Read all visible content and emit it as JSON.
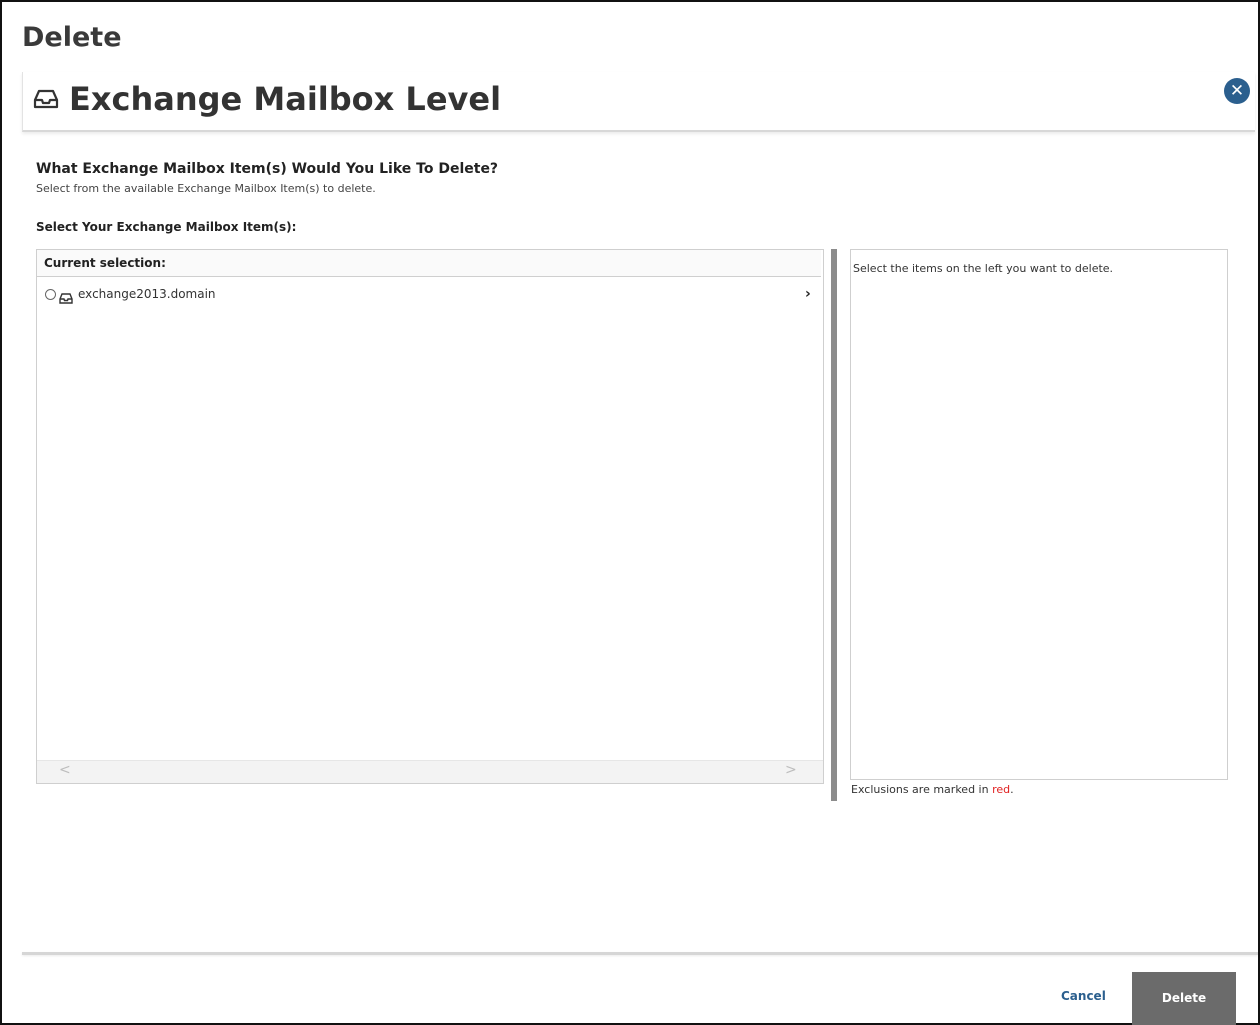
{
  "window": {
    "title": "Delete"
  },
  "header": {
    "icon": "mailbox-icon",
    "title": "Exchange Mailbox Level",
    "close_icon": "close-icon"
  },
  "prompt": {
    "question": "What Exchange Mailbox Item(s) Would You Like To Delete?",
    "subtext": "Select from the available Exchange Mailbox Item(s) to delete.",
    "select_label": "Select Your Exchange Mailbox Item(s):"
  },
  "left_panel": {
    "header": "Current selection:",
    "items": [
      {
        "label": "exchange2013.domain",
        "icon": "mailbox-icon",
        "selected": false,
        "expand_icon": "chevron-right-icon"
      }
    ],
    "scroll_left": "<",
    "scroll_right": ">"
  },
  "right_panel": {
    "hint": "Select the items on the left you want to delete.",
    "exclusions_prefix": "Exclusions are marked in ",
    "exclusions_red": "red",
    "exclusions_suffix": "."
  },
  "footer": {
    "cancel_label": "Cancel",
    "delete_label": "Delete"
  },
  "colors": {
    "accent": "#2b5f8e",
    "delete_button": "#6b6b6b",
    "exclusion_red": "#e02020"
  }
}
